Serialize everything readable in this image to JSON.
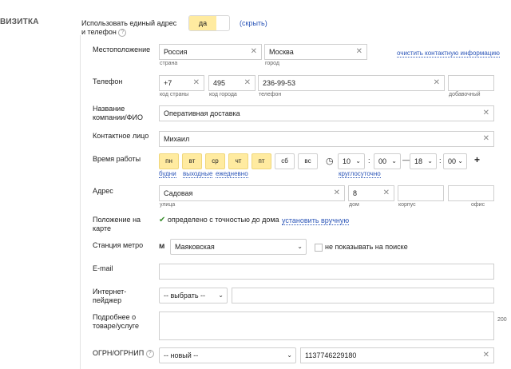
{
  "section": {
    "title": "ВИЗИТКА"
  },
  "single_address": {
    "label_line1": "Использовать единый адрес",
    "label_line2": "и телефон",
    "toggle_value": "да",
    "hide_link": "(скрыть)"
  },
  "location": {
    "label": "Местоположение",
    "country_value": "Россия",
    "country_caption": "страна",
    "city_value": "Москва",
    "city_caption": "город",
    "clear_link": "очистить контактную информацию"
  },
  "phone": {
    "label": "Телефон",
    "country_code": "+7",
    "country_code_caption": "код страны",
    "city_code": "495",
    "city_code_caption": "код города",
    "number": "236-99-53",
    "number_caption": "телефон",
    "extension": "",
    "extension_caption": "добавочный"
  },
  "company": {
    "label_line1": "Название",
    "label_line2": "компании/ФИО",
    "value": "Оперативная доставка"
  },
  "contact": {
    "label": "Контактное лицо",
    "value": "Михаил"
  },
  "hours": {
    "label": "Время работы",
    "days": [
      {
        "label": "пн",
        "active": true
      },
      {
        "label": "вт",
        "active": true
      },
      {
        "label": "ср",
        "active": true
      },
      {
        "label": "чт",
        "active": true
      },
      {
        "label": "пт",
        "active": true
      },
      {
        "label": "сб",
        "active": false
      },
      {
        "label": "вс",
        "active": false
      }
    ],
    "preset_weekdays": "будни",
    "preset_weekends": "выходные",
    "preset_daily": "ежедневно",
    "from_hour": "10",
    "from_min": "00",
    "dash": "—",
    "to_hour": "18",
    "to_min": "00",
    "colon": ":",
    "around_clock": "круглосуточно",
    "add": "+"
  },
  "address": {
    "label": "Адрес",
    "street_value": "Садовая",
    "street_caption": "улица",
    "house_value": "8",
    "house_caption": "дом",
    "building_value": "",
    "building_caption": "корпус",
    "office_value": "",
    "office_caption": "офис"
  },
  "map_position": {
    "label_line1": "Положение на",
    "label_line2": "карте",
    "status": "определено с точностью до дома",
    "manual_link": "установить вручную"
  },
  "metro": {
    "label": "Станция метро",
    "value": "Маяковская",
    "hide_label": "не показывать на поиске"
  },
  "email": {
    "label": "E-mail",
    "value": ""
  },
  "messenger": {
    "label_line1": "Интернет-",
    "label_line2": "пейджер",
    "select_value": "-- выбрать --",
    "value": ""
  },
  "details": {
    "label_line1": "Подробнее о",
    "label_line2": "товаре/услуге",
    "value": "",
    "counter": "200"
  },
  "ogrn": {
    "label": "ОГРН/ОГРНИП",
    "select_value": "-- новый --",
    "value": "1137746229180"
  }
}
